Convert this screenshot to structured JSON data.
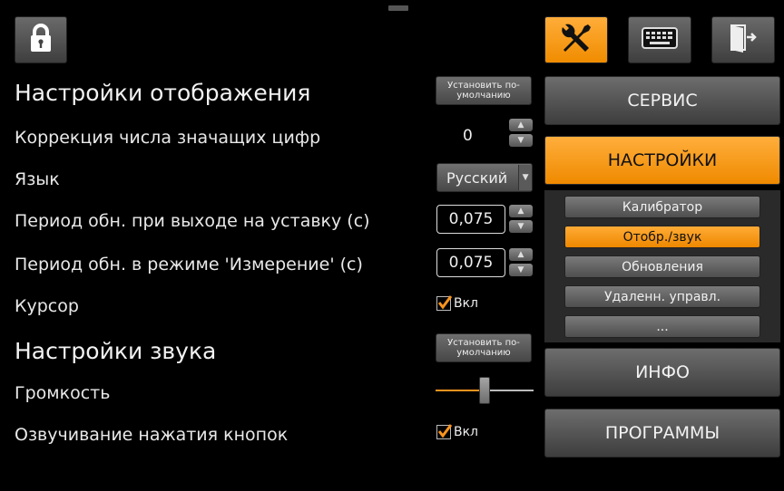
{
  "toolbar": {
    "lock_icon": "lock-icon",
    "settings_icon": "tools-icon",
    "keyboard_icon": "keyboard-icon",
    "exit_icon": "exit-door-icon",
    "accent_color": "#f7931e"
  },
  "display": {
    "heading": "Настройки отображения",
    "default_label": "Установить по-умолчанию",
    "digits_label": "Коррекция числа значащих цифр",
    "digits_value": "0",
    "language_label": "Язык",
    "language_value": "Русский",
    "setpoint_period_label": "Период обн. при выходе на уставку (с)",
    "setpoint_period_value": "0,075",
    "measure_period_label": "Период обн. в режиме 'Измерение' (с)",
    "measure_period_value": "0,075",
    "cursor_label": "Курсор",
    "cursor_check_label": "Вкл",
    "cursor_checked": true
  },
  "sound": {
    "heading": "Настройки звука",
    "default_label": "Установить по-умолчанию",
    "volume_label": "Громкость",
    "volume_level": 0.5,
    "click_sound_label": "Озвучивание нажатия кнопок",
    "click_check_label": "Вкл",
    "click_checked": true
  },
  "menu": {
    "service": "СЕРВИС",
    "settings": "НАСТРОЙКИ",
    "sub_items": [
      "Калибратор",
      "Отобр./звук",
      "Обновления",
      "Удаленн. управл.",
      "..."
    ],
    "sub_active": "Отобр./звук",
    "info": "ИНФО",
    "programs": "ПРОГРАММЫ"
  }
}
